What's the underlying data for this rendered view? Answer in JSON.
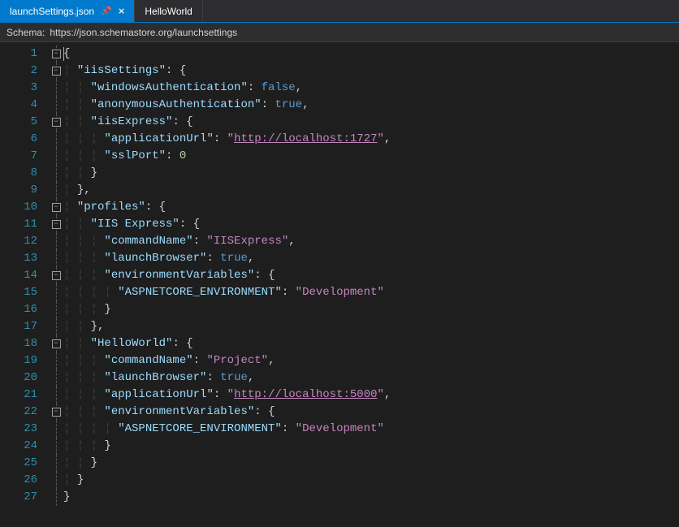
{
  "tabs": [
    {
      "label": "launchSettings.json",
      "active": true,
      "pinned": true
    },
    {
      "label": "HelloWorld",
      "active": false
    }
  ],
  "schema_bar": {
    "label": "Schema:",
    "url": "https://json.schemastore.org/launchsettings"
  },
  "line_count": 27,
  "folds": {
    "1": "minus",
    "2": "minus",
    "5": "minus",
    "10": "minus",
    "11": "minus",
    "14": "minus",
    "18": "minus",
    "22": "minus"
  },
  "code": {
    "iisSettings_key": "\"iisSettings\"",
    "windowsAuthentication_key": "\"windowsAuthentication\"",
    "windowsAuthentication_val": "false",
    "anonymousAuthentication_key": "\"anonymousAuthentication\"",
    "anonymousAuthentication_val": "true",
    "iisExpress_key": "\"iisExpress\"",
    "applicationUrl_key": "\"applicationUrl\"",
    "iisExpress_applicationUrl_val": "http://localhost:1727",
    "sslPort_key": "\"sslPort\"",
    "sslPort_val": "0",
    "profiles_key": "\"profiles\"",
    "profile_iis_name": "\"IIS Express\"",
    "commandName_key": "\"commandName\"",
    "iis_commandName_val": "\"IISExpress\"",
    "launchBrowser_key": "\"launchBrowser\"",
    "launchBrowser_val": "true",
    "environmentVariables_key": "\"environmentVariables\"",
    "envvar_key": "\"ASPNETCORE_ENVIRONMENT\"",
    "envvar_val": "\"Development\"",
    "profile_hw_name": "\"HelloWorld\"",
    "hw_commandName_val": "\"Project\"",
    "hw_applicationUrl_val": "http://localhost:5000"
  }
}
